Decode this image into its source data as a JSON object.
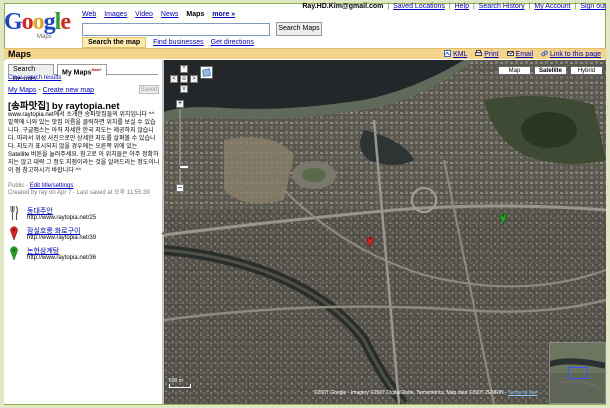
{
  "header": {
    "logo_text": "Google",
    "logo_sub": "Maps",
    "nav": [
      "Web",
      "Images",
      "Video",
      "News",
      "Maps",
      "more »"
    ],
    "nav_current": "Maps",
    "user_email": "Ray.HD.Kim@gmail.com",
    "user_links": [
      "Saved Locations",
      "Help",
      "Search History",
      "My Account",
      "Sign out"
    ],
    "search": {
      "value": "",
      "button_label": "Search Maps"
    },
    "subtabs": {
      "active": "Search the map",
      "links": [
        "Find businesses",
        "Get directions"
      ]
    }
  },
  "maps_bar": {
    "title": "Maps",
    "tools": [
      {
        "icon": "kml-icon",
        "label": "KML"
      },
      {
        "icon": "print-icon",
        "label": "Print"
      },
      {
        "icon": "email-icon",
        "label": "Email"
      },
      {
        "icon": "link-icon",
        "label": "Link to this page"
      }
    ]
  },
  "left_panel": {
    "tabs": {
      "search": "Search Results",
      "mine": "My Maps",
      "mine_badge": "New!"
    },
    "clear_label": "Clear search results",
    "crumb": {
      "my_maps": "My Maps",
      "separator": " - ",
      "create": "Create new map"
    },
    "saved_label": "Saved",
    "map_title": "[송파맛집] by raytopia.net",
    "description": "www.raytopia.net에서 소개한 송파맛집들의 위치입니다 ^^ 밑쪽에 나와 있는 맛집 이름을 클릭하면 위치를 보실 수 있습니다. 구글맵스는 아직 자세한 한국 지도는 제공하지 않습니다. 따라서 위성 사진으로만 상세한 지도를 살펴볼 수 있습니다. 지도가 표시되지 않을 경우에는 오른쪽 위에 있는 Satellite 버튼을 눌러주세요. 참고로 이 위치들은 아주 정확하지는 않고 대략 그 정도 지점이라는 것을 알려드리는 정도이니 이 점 참고하시기 바랍니다 ^^",
    "meta_public": "Public",
    "meta_edit": "Edit title/settings",
    "meta_created": "Created by ray on Apr 7 - Last saved at 오후 11:55:39",
    "places": [
      {
        "name": "동대주안",
        "url": "http://www.raytopia.net/25",
        "icon": "restaurant-icon",
        "color": "#555555"
      },
      {
        "name": "잠실호롱 화로구이",
        "url": "http://www.raytopia.net/39",
        "icon": "red-pin-icon",
        "color": "#e02020"
      },
      {
        "name": "논현삼계탕",
        "url": "http://www.raytopia.net/36",
        "icon": "green-pin-icon",
        "color": "#20a020"
      }
    ]
  },
  "map": {
    "type_buttons": [
      "Map",
      "Satellite",
      "Hybrid"
    ],
    "active_type": "Satellite",
    "scale_label": "500 m",
    "copyright": "©2007 Google - Imagery ©2007 DigitalGlobe, Terrametrics, Map data ©2007 ZENRIN",
    "terms_label": "Terms of Use",
    "pan_labels": {
      "up": "^",
      "left": "<",
      "right": ">",
      "down": "v",
      "center": "o"
    },
    "zoom_in_label": "+",
    "zoom_out_label": "–"
  }
}
